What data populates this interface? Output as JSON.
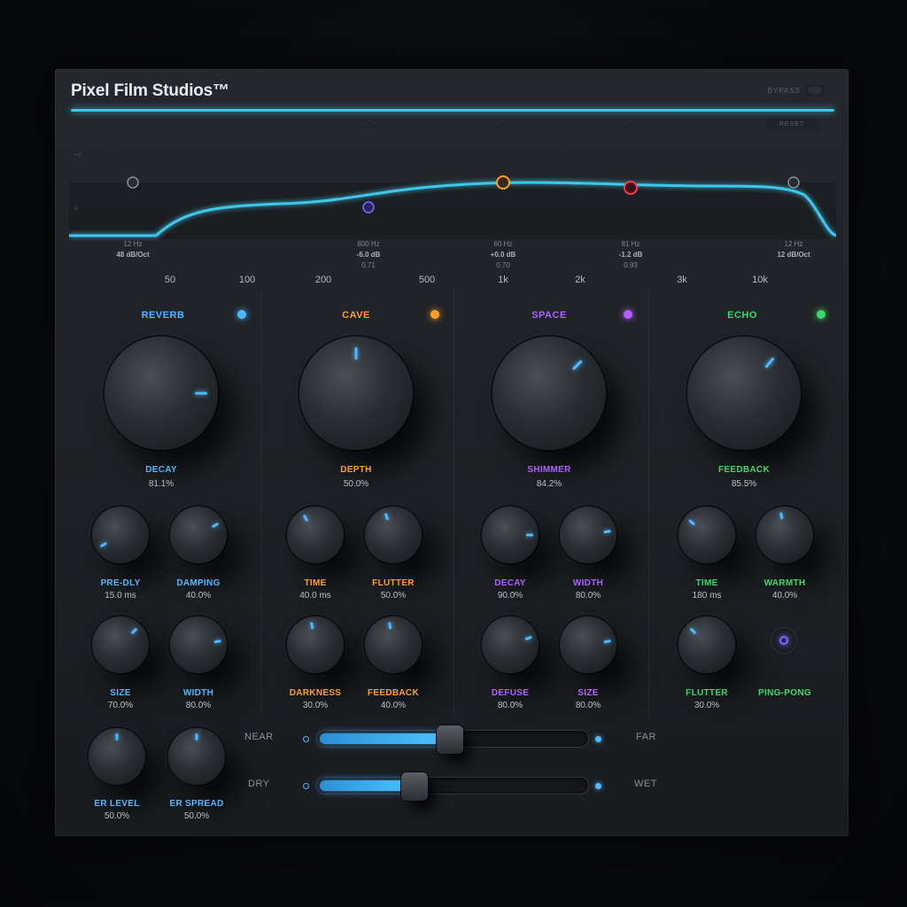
{
  "brand": "Pixel Film Studios™",
  "header": {
    "bypass_label": "BYPASS",
    "range_label": "RESET"
  },
  "colors": {
    "accent": "#3fc6ea",
    "reverb": "#4fb8ff",
    "cave": "#ff9d2e",
    "space": "#b060ff",
    "echo": "#39d86a"
  },
  "eq": {
    "freq_labels": [
      "50",
      "100",
      "200",
      "500",
      "1k",
      "2k",
      "3k",
      "10k"
    ],
    "bands": [
      {
        "freq": "12 Hz",
        "gain": "48 dB/Oct",
        "q": ""
      },
      {
        "freq": "800 Hz",
        "gain": "-6.0 dB",
        "q": "0.71"
      },
      {
        "freq": "60 Hz",
        "gain": "+0.0 dB",
        "q": "0.70"
      },
      {
        "freq": "81 Hz",
        "gain": "-1.2 dB",
        "q": "0.93"
      },
      {
        "freq": "12 Hz",
        "gain": "12 dB/Oct",
        "q": ""
      }
    ]
  },
  "modules": {
    "reverb": {
      "title": "REVERB",
      "main": {
        "label": "DECAY",
        "value": "81.1%"
      },
      "knobs": [
        {
          "label": "PRE-DLY",
          "value": "15.0 ms"
        },
        {
          "label": "DAMPING",
          "value": "40.0%"
        },
        {
          "label": "SIZE",
          "value": "70.0%"
        },
        {
          "label": "WIDTH",
          "value": "80.0%"
        },
        {
          "label": "ER LEVEL",
          "value": "50.0%"
        },
        {
          "label": "ER SPREAD",
          "value": "50.0%"
        }
      ]
    },
    "cave": {
      "title": "CAVE",
      "main": {
        "label": "DEPTH",
        "value": "50.0%"
      },
      "knobs": [
        {
          "label": "TIME",
          "value": "40.0 ms"
        },
        {
          "label": "FLUTTER",
          "value": "50.0%"
        },
        {
          "label": "DARKNESS",
          "value": "30.0%"
        },
        {
          "label": "FEEDBACK",
          "value": "40.0%"
        }
      ]
    },
    "space": {
      "title": "SPACE",
      "main": {
        "label": "SHIMMER",
        "value": "84.2%"
      },
      "knobs": [
        {
          "label": "DECAY",
          "value": "90.0%"
        },
        {
          "label": "WIDTH",
          "value": "80.0%"
        },
        {
          "label": "DEFUSE",
          "value": "80.0%"
        },
        {
          "label": "SIZE",
          "value": "80.0%"
        }
      ]
    },
    "echo": {
      "title": "ECHO",
      "main": {
        "label": "FEEDBACK",
        "value": "85.5%"
      },
      "knobs": [
        {
          "label": "TIME",
          "value": "180 ms"
        },
        {
          "label": "WARMTH",
          "value": "40.0%"
        },
        {
          "label": "FLUTTER",
          "value": "30.0%"
        }
      ],
      "toggle": {
        "label": "PING-PONG"
      }
    }
  },
  "sliders": {
    "near_far": {
      "left": "NEAR",
      "right": "FAR",
      "value": 0.49
    },
    "dry_wet": {
      "left": "DRY",
      "right": "WET",
      "value": 0.36
    }
  }
}
